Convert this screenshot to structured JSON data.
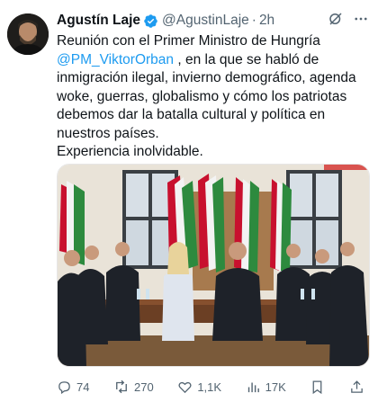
{
  "tweet": {
    "author_name": "Agustín Laje",
    "handle": "@AgustinLaje",
    "separator": "·",
    "time": "2h",
    "text_lines": [
      "Reunión con el Primer Ministro de Hungría",
      "@PM_ViktorOrban",
      ", en la que se habló de",
      "inmigración ilegal, invierno demográfico, agenda",
      "woke, guerras, globalismo y cómo los patriotas",
      "debemos dar la batalla cultural y política en",
      "nuestros países.",
      "Experiencia inolvidable."
    ]
  },
  "header_icons": [
    "grok-icon",
    "more-options-icon"
  ],
  "actions": {
    "replies": "74",
    "reposts": "270",
    "likes": "1,1K",
    "views": "17K"
  },
  "colors": {
    "text": "#0f1419",
    "secondary": "#536471",
    "link": "#1d9bf0",
    "verified": "#1d9bf0"
  }
}
